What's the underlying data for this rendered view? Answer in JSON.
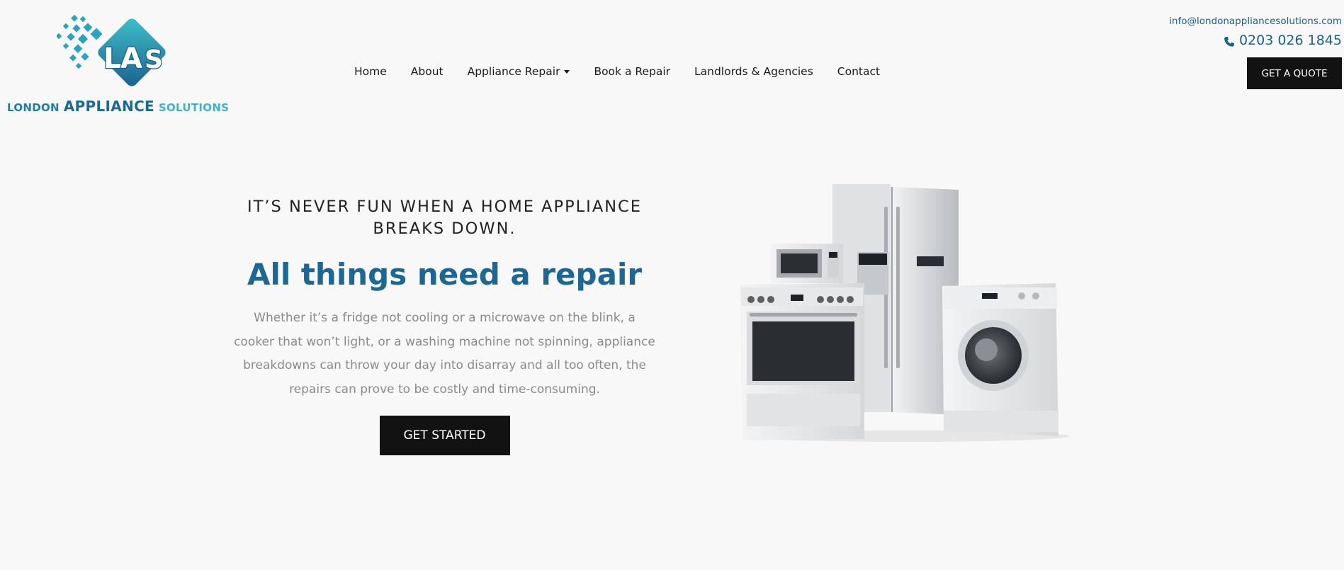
{
  "brand": {
    "logo_mark": "LAS",
    "name_part1": "LONDON",
    "name_part2": "APPLIANCE",
    "name_part3": "SOLUTIONS"
  },
  "nav": {
    "items": [
      {
        "label": "Home"
      },
      {
        "label": "About"
      },
      {
        "label": "Appliance Repair",
        "dropdown": true
      },
      {
        "label": "Book a Repair"
      },
      {
        "label": "Landlords & Agencies"
      },
      {
        "label": "Contact"
      }
    ]
  },
  "contact": {
    "email": "info@londonappliancesolutions.com",
    "phone": "0203 026 1845",
    "phone_icon": "phone-icon",
    "quote_label": "GET A QUOTE"
  },
  "hero": {
    "kicker": "IT’S NEVER FUN WHEN A HOME APPLIANCE BREAKS DOWN.",
    "headline": "All things need a repair",
    "body": "Whether it’s a fridge not cooling or a microwave on the blink, a cooker that won’t light, or a washing machine not spinning, appliance breakdowns can throw your day into disarray and all too often, the repairs can prove to be costly and time-consuming.",
    "cta_label": "GET STARTED"
  },
  "colors": {
    "background": "#f8f8f9",
    "brand_blue": "#1c6893",
    "brand_teal": "#3fb1c9",
    "button_bg": "#121212"
  }
}
